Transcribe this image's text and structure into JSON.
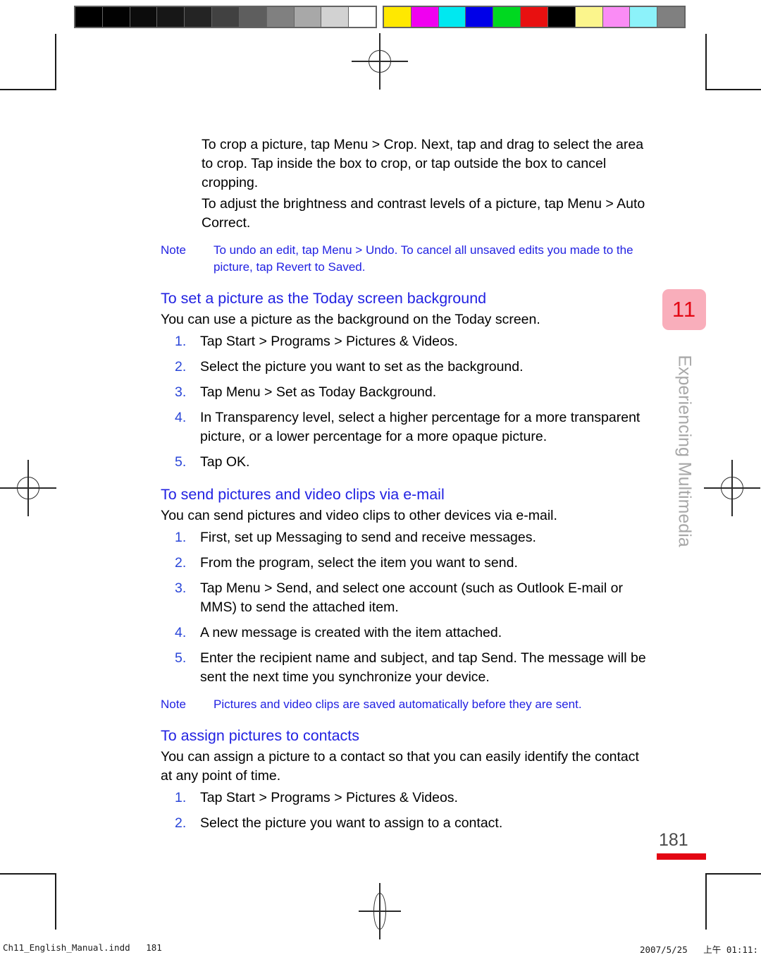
{
  "calibration": {
    "grayscale_label": "grayscale-calibration-bar",
    "color_label": "color-calibration-bar",
    "grayscale_swatches": [
      "#000000",
      "#020202",
      "#0c0c0c",
      "#171717",
      "#242424",
      "#414141",
      "#5e5e5e",
      "#808080",
      "#a8a8a8",
      "#d2d2d2",
      "#ffffff"
    ],
    "color_swatches": [
      "#ffe800",
      "#f000f0",
      "#00e8f0",
      "#0000e8",
      "#00d820",
      "#e81010",
      "#000000",
      "#fbf58c",
      "#fa8cf5",
      "#8cf2fa",
      "#808080"
    ]
  },
  "content": {
    "paragraphs_top": [
      "To crop a picture, tap Menu > Crop. Next, tap and drag to select the area to crop. Tap inside the box to crop, or tap outside the box to cancel cropping.",
      "To adjust the brightness and contrast levels of a picture, tap Menu > Auto Correct."
    ],
    "note_1": {
      "label": "Note",
      "text": "To undo an edit, tap Menu > Undo. To cancel all unsaved edits you made to the picture, tap Revert to Saved."
    },
    "section_1": {
      "heading": "To set a picture as the Today screen background",
      "intro": "You can use a picture as the background on the Today screen.",
      "steps": [
        {
          "num": "1.",
          "text": "Tap Start > Programs > Pictures & Videos."
        },
        {
          "num": "2.",
          "text": "Select the picture you want to set as the background."
        },
        {
          "num": "3.",
          "text": "Tap Menu > Set as Today Background."
        },
        {
          "num": "4.",
          "text": "In Transparency level, select a higher percentage for a more transparent picture, or a lower percentage for a more opaque picture."
        },
        {
          "num": "5.",
          "text": "Tap OK."
        }
      ]
    },
    "section_2": {
      "heading": "To send pictures and video clips via e-mail",
      "intro": "You can send pictures and video clips to other devices via e-mail.",
      "steps": [
        {
          "num": "1.",
          "text": "First, set up Messaging to send and receive messages."
        },
        {
          "num": "2.",
          "text": "From the program, select the item you want to send."
        },
        {
          "num": "3.",
          "text": "Tap Menu > Send, and select one account (such as Outlook E-mail or MMS) to send the attached item."
        },
        {
          "num": "4.",
          "text": "A new message is created with the item attached."
        },
        {
          "num": "5.",
          "text": "Enter the recipient name and subject, and tap Send. The message will be sent the next time you synchronize your device."
        }
      ]
    },
    "note_2": {
      "label": "Note",
      "text": "Pictures and video clips are saved automatically before they are sent."
    },
    "section_3": {
      "heading": "To assign pictures to contacts",
      "intro": "You can assign a picture to a contact so that you can easily identify the contact at any point of time.",
      "steps": [
        {
          "num": "1.",
          "text": "Tap Start > Programs > Pictures & Videos."
        },
        {
          "num": "2.",
          "text": "Select the picture you want to assign to a contact."
        }
      ]
    }
  },
  "chapter_tab": {
    "number": "11",
    "title": "Experiencing Multimedia",
    "tab_color": "#f9aebb",
    "number_color": "#e30613",
    "title_color": "#a8a8a8"
  },
  "page_number": {
    "value": "181",
    "rule_color": "#e30613"
  },
  "footer": {
    "left": "Ch11_English_Manual.indd   181",
    "right": "2007/5/25   上午 01:11:"
  }
}
